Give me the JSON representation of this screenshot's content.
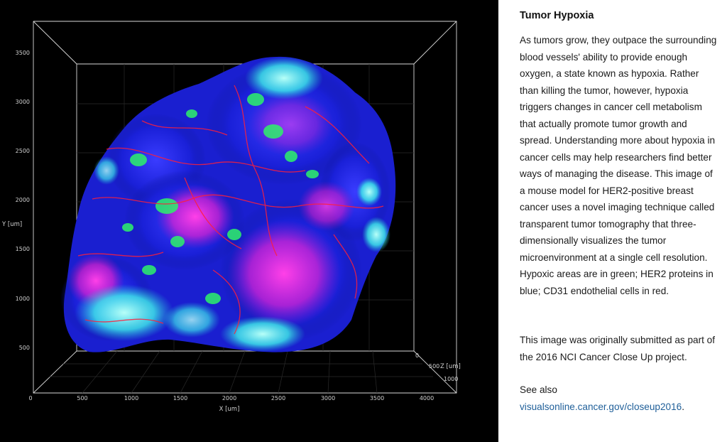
{
  "viewer": {
    "y_axis_label": "Y [um]",
    "x_axis_label": "X [um]",
    "z_axis_label": "Z [um]",
    "y_ticks": [
      "3500",
      "3000",
      "2500",
      "2000",
      "1500",
      "1000",
      "500"
    ],
    "x_ticks": [
      "0",
      "500",
      "1000",
      "1500",
      "2000",
      "2500",
      "3000",
      "3500",
      "4000"
    ],
    "x_origin": "0",
    "z_ticks": [
      "0",
      "500",
      "1000"
    ],
    "colors": {
      "hypoxia": "#2ef26a",
      "her2": "#1e2cff",
      "cd31": "#ff1f3a",
      "overlap_magenta": "#ff30e0",
      "overlap_cyan": "#3ff0ea",
      "background": "#000000",
      "frame": "#d9d9d9"
    }
  },
  "article": {
    "title": "Tumor Hypoxia",
    "body": "As tumors grow, they outpace the surrounding blood vessels' ability to provide enough oxygen, a state known as hypoxia. Rather than killing the tumor, however, hypoxia triggers changes in cancer cell metabolism that actually promote tumor growth and spread. Understanding more about hypoxia in cancer cells may help researchers find better ways of managing the disease. This image of a mouse model for HER2-positive breast cancer uses a novel imaging technique called transparent tumor tomography that three-dimensionally visualizes the tumor microenvironment at a single cell resolution. Hypoxic areas are in green; HER2 proteins in blue; CD31 endothelial cells in red.",
    "credit": "This image was originally submitted as part of the 2016 NCI Cancer Close Up project.",
    "see_also_label": "See also",
    "link_text": "visualsonline.cancer.gov/closeup2016",
    "link_suffix": "."
  }
}
